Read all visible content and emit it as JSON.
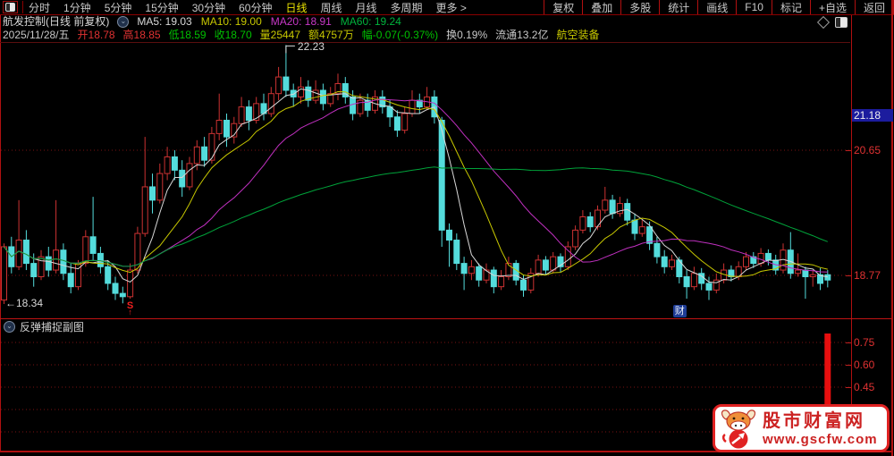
{
  "toolbar": {
    "periods": [
      "分时",
      "1分钟",
      "5分钟",
      "15分钟",
      "30分钟",
      "60分钟",
      "日线",
      "周线",
      "月线",
      "多周期",
      "更多 >"
    ],
    "active_period": "日线",
    "right_buttons": [
      "复权",
      "叠加",
      "多股",
      "统计",
      "画线",
      "F10",
      "标记",
      "+自选",
      "返回"
    ]
  },
  "info": {
    "title": "航发控制(日线 前复权)",
    "ma_values": [
      {
        "text": "MA5: 19.03",
        "color": "#d8d8d8"
      },
      {
        "text": "MA10: 19.00",
        "color": "#c8c800"
      },
      {
        "text": "MA20: 18.91",
        "color": "#c838c8"
      },
      {
        "text": "MA60: 19.24",
        "color": "#00b43c"
      }
    ],
    "quote": [
      {
        "text": "2025/11/28/五",
        "color": "#c8c8c8"
      },
      {
        "text": "开18.78",
        "color": "#e03232"
      },
      {
        "text": "高18.85",
        "color": "#e03232"
      },
      {
        "text": "低18.59",
        "color": "#00c000"
      },
      {
        "text": "收18.70",
        "color": "#00c000"
      },
      {
        "text": "量25447",
        "color": "#c8c800"
      },
      {
        "text": "额4757万",
        "color": "#c8c800"
      },
      {
        "text": "幅-0.07(-0.37%)",
        "color": "#00c000"
      },
      {
        "text": "换0.19%",
        "color": "#c8c8c8"
      },
      {
        "text": "流通13.2亿",
        "color": "#c8c8c8"
      },
      {
        "text": "航空装备",
        "color": "#c8c800"
      }
    ]
  },
  "watermark": {
    "site_name": "股市财富网",
    "site_url": "www.gscfw.com"
  },
  "chart_data": {
    "type": "candlestick",
    "title": "航发控制 日线 前复权",
    "colors": {
      "up": "#cc3232",
      "down": "#54dcdc",
      "grid": "#7a1212",
      "axis": "#b01010"
    },
    "price_axis": {
      "labels": [
        21.18,
        20.65,
        18.77
      ],
      "highlight_label": 21.18,
      "gridline_prices": [
        22.53,
        20.65,
        18.77
      ],
      "peak_label": "22.23",
      "low_label": "←18.34",
      "peak_price": 22.23,
      "low_price": 18.34
    },
    "ma": {
      "periods": [
        5,
        10,
        20,
        60
      ],
      "colors": [
        "#d8d8d8",
        "#c8c800",
        "#c030c0",
        "#00a33a"
      ],
      "latest": {
        "MA5": 19.03,
        "MA10": 19.0,
        "MA20": 18.91,
        "MA60": 19.24
      }
    },
    "markers": [
      {
        "index": 17,
        "label": "S",
        "arrow": "↑",
        "type": "signal"
      },
      {
        "index": 91,
        "label": "财",
        "type": "report-badge"
      }
    ],
    "peak_annotation": {
      "index": 38
    },
    "candles": [
      [
        18.4,
        19.25,
        18.34,
        19.2
      ],
      [
        19.2,
        19.35,
        18.8,
        18.9
      ],
      [
        18.9,
        19.9,
        18.85,
        19.3
      ],
      [
        19.3,
        19.45,
        18.85,
        18.95
      ],
      [
        18.95,
        19.1,
        18.6,
        18.75
      ],
      [
        18.75,
        19.15,
        18.7,
        19.05
      ],
      [
        19.05,
        19.2,
        18.75,
        18.85
      ],
      [
        18.85,
        19.9,
        18.8,
        19.15
      ],
      [
        19.15,
        19.25,
        18.7,
        18.8
      ],
      [
        18.8,
        18.95,
        18.5,
        18.6
      ],
      [
        18.6,
        19.0,
        18.55,
        18.95
      ],
      [
        18.95,
        19.45,
        18.9,
        19.35
      ],
      [
        19.35,
        19.95,
        19.0,
        19.1
      ],
      [
        19.1,
        19.2,
        18.8,
        18.9
      ],
      [
        18.9,
        19.0,
        18.55,
        18.65
      ],
      [
        18.65,
        18.75,
        18.4,
        18.5
      ],
      [
        18.5,
        18.6,
        18.35,
        18.45
      ],
      [
        18.45,
        18.95,
        18.42,
        18.85
      ],
      [
        18.85,
        19.5,
        18.8,
        19.4
      ],
      [
        19.4,
        20.85,
        19.35,
        20.1
      ],
      [
        20.1,
        20.3,
        19.7,
        19.9
      ],
      [
        19.9,
        20.45,
        19.85,
        20.3
      ],
      [
        20.3,
        20.7,
        20.2,
        20.55
      ],
      [
        20.55,
        20.65,
        20.2,
        20.35
      ],
      [
        20.35,
        20.5,
        19.95,
        20.1
      ],
      [
        20.1,
        20.55,
        20.05,
        20.45
      ],
      [
        20.45,
        20.8,
        20.35,
        20.7
      ],
      [
        20.7,
        20.85,
        20.4,
        20.5
      ],
      [
        20.5,
        21.0,
        20.45,
        20.9
      ],
      [
        20.9,
        21.5,
        20.8,
        21.1
      ],
      [
        21.1,
        21.2,
        20.7,
        20.85
      ],
      [
        20.85,
        21.15,
        20.75,
        21.05
      ],
      [
        21.05,
        21.45,
        21.0,
        21.3
      ],
      [
        21.3,
        21.4,
        20.95,
        21.1
      ],
      [
        21.1,
        21.45,
        21.05,
        21.35
      ],
      [
        21.35,
        21.5,
        21.1,
        21.2
      ],
      [
        21.2,
        21.6,
        21.15,
        21.5
      ],
      [
        21.5,
        21.9,
        21.4,
        21.75
      ],
      [
        21.75,
        22.23,
        21.45,
        21.55
      ],
      [
        21.55,
        21.65,
        21.3,
        21.45
      ],
      [
        21.45,
        21.75,
        21.35,
        21.6
      ],
      [
        21.6,
        21.7,
        21.3,
        21.4
      ],
      [
        21.4,
        21.7,
        21.35,
        21.55
      ],
      [
        21.55,
        21.65,
        21.25,
        21.35
      ],
      [
        21.35,
        21.6,
        21.3,
        21.5
      ],
      [
        21.5,
        21.8,
        21.4,
        21.65
      ],
      [
        21.65,
        21.75,
        21.35,
        21.45
      ],
      [
        21.45,
        21.55,
        21.1,
        21.2
      ],
      [
        21.2,
        21.5,
        21.15,
        21.4
      ],
      [
        21.4,
        21.5,
        21.15,
        21.25
      ],
      [
        21.25,
        21.55,
        21.2,
        21.45
      ],
      [
        21.45,
        21.55,
        21.2,
        21.3
      ],
      [
        21.3,
        21.4,
        21.0,
        21.15
      ],
      [
        21.15,
        21.25,
        20.85,
        20.95
      ],
      [
        20.95,
        21.3,
        20.9,
        21.2
      ],
      [
        21.2,
        21.55,
        21.15,
        21.4
      ],
      [
        21.4,
        21.5,
        21.2,
        21.3
      ],
      [
        21.3,
        21.6,
        21.25,
        21.45
      ],
      [
        21.45,
        21.55,
        21.05,
        21.15
      ],
      [
        21.1,
        21.15,
        19.2,
        19.45
      ],
      [
        19.45,
        19.55,
        18.9,
        19.3
      ],
      [
        19.3,
        19.4,
        18.85,
        18.95
      ],
      [
        18.95,
        19.05,
        18.55,
        18.8
      ],
      [
        18.8,
        19.0,
        18.7,
        18.9
      ],
      [
        18.9,
        18.95,
        18.6,
        18.7
      ],
      [
        18.7,
        18.95,
        18.65,
        18.85
      ],
      [
        18.85,
        18.9,
        18.5,
        18.6
      ],
      [
        18.6,
        18.85,
        18.55,
        18.75
      ],
      [
        18.75,
        19.05,
        18.7,
        18.95
      ],
      [
        18.95,
        19.0,
        18.62,
        18.7
      ],
      [
        18.7,
        18.78,
        18.45,
        18.55
      ],
      [
        18.55,
        18.88,
        18.5,
        18.8
      ],
      [
        18.8,
        19.08,
        18.75,
        19.0
      ],
      [
        19.0,
        19.06,
        18.78,
        18.85
      ],
      [
        18.85,
        19.12,
        18.8,
        19.05
      ],
      [
        19.05,
        19.1,
        18.82,
        18.9
      ],
      [
        18.9,
        19.28,
        18.85,
        19.2
      ],
      [
        19.2,
        19.52,
        19.15,
        19.45
      ],
      [
        19.45,
        19.75,
        19.4,
        19.65
      ],
      [
        19.65,
        19.72,
        19.42,
        19.5
      ],
      [
        19.5,
        19.82,
        19.45,
        19.75
      ],
      [
        19.75,
        20.1,
        19.7,
        19.9
      ],
      [
        19.9,
        19.98,
        19.62,
        19.7
      ],
      [
        19.7,
        19.95,
        19.65,
        19.85
      ],
      [
        19.85,
        19.92,
        19.52,
        19.6
      ],
      [
        19.6,
        19.7,
        19.3,
        19.4
      ],
      [
        19.4,
        19.6,
        19.35,
        19.5
      ],
      [
        19.5,
        19.58,
        19.15,
        19.25
      ],
      [
        19.25,
        19.35,
        18.95,
        19.05
      ],
      [
        19.05,
        19.15,
        18.8,
        18.9
      ],
      [
        18.9,
        19.08,
        18.85,
        19.0
      ],
      [
        19.0,
        19.05,
        18.65,
        18.75
      ],
      [
        18.75,
        18.85,
        18.42,
        18.6
      ],
      [
        18.6,
        18.9,
        18.55,
        18.8
      ],
      [
        18.8,
        18.88,
        18.55,
        18.65
      ],
      [
        18.65,
        18.75,
        18.4,
        18.55
      ],
      [
        18.55,
        18.8,
        18.5,
        18.7
      ],
      [
        18.7,
        18.95,
        18.65,
        18.85
      ],
      [
        18.85,
        18.92,
        18.68,
        18.75
      ],
      [
        18.75,
        18.98,
        18.7,
        18.9
      ],
      [
        18.9,
        19.12,
        18.85,
        19.05
      ],
      [
        19.05,
        19.12,
        18.88,
        18.95
      ],
      [
        18.95,
        19.18,
        18.9,
        19.1
      ],
      [
        19.1,
        19.16,
        18.92,
        19.0
      ],
      [
        19.0,
        19.08,
        18.78,
        18.85
      ],
      [
        18.85,
        19.25,
        18.8,
        19.15
      ],
      [
        19.15,
        19.42,
        18.72,
        18.8
      ],
      [
        18.8,
        19.1,
        18.75,
        18.85
      ],
      [
        18.85,
        18.9,
        18.42,
        18.75
      ],
      [
        18.75,
        18.85,
        18.6,
        18.78
      ],
      [
        18.78,
        18.88,
        18.55,
        18.65
      ],
      [
        18.78,
        18.85,
        18.59,
        18.7
      ]
    ],
    "sub_indicator": {
      "name": "反弹捕捉副图",
      "type": "bar",
      "axis_labels": [
        "0.75",
        "0.60",
        "0.45"
      ],
      "grid_values": [
        0.75,
        0.6,
        0.45,
        0.3,
        0.15
      ],
      "bars": [
        {
          "index": 111,
          "value": 0.81,
          "color": "#e80e0e"
        }
      ]
    }
  }
}
